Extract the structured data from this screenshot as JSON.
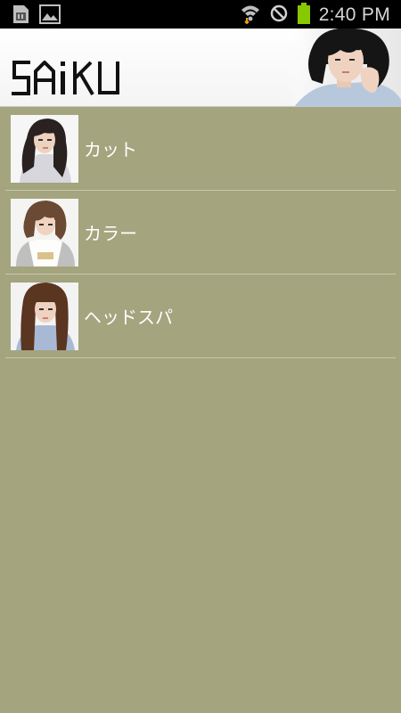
{
  "status_bar": {
    "time": "2:40 PM",
    "icons": [
      "sim-card-icon",
      "image-icon",
      "wifi-icon",
      "no-sign-icon",
      "battery-icon"
    ]
  },
  "header": {
    "logo_text": "SAiKU"
  },
  "menu": {
    "items": [
      {
        "label": "カット",
        "icon": "cut-photo"
      },
      {
        "label": "カラー",
        "icon": "color-photo"
      },
      {
        "label": "ヘッドスパ",
        "icon": "headspa-photo"
      }
    ]
  },
  "colors": {
    "background": "#a4a47e",
    "divider": "#c8c8ad",
    "label": "#ffffff"
  }
}
